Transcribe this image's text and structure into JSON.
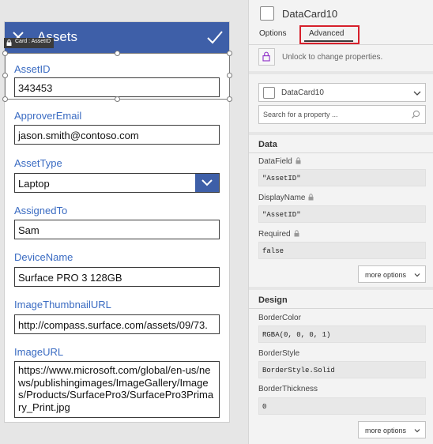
{
  "form": {
    "title": "Assets",
    "card_tag": "Card : AssetID",
    "fields": [
      {
        "label": "AssetID",
        "value": "343453"
      },
      {
        "label": "ApproverEmail",
        "value": "jason.smith@contoso.com"
      },
      {
        "label": "AssetType",
        "value": "Laptop"
      },
      {
        "label": "AssignedTo",
        "value": "Sam"
      },
      {
        "label": "DeviceName",
        "value": "Surface PRO 3 128GB"
      },
      {
        "label": "ImageThumbnailURL",
        "value": "http://compass.surface.com/assets/09/73."
      },
      {
        "label": "ImageURL",
        "value": "https://www.microsoft.com/global/en-us/news/publishingimages/ImageGallery/Images/Products/SurfacePro3/SurfacePro3Primary_Print.jpg"
      }
    ]
  },
  "panel": {
    "title": "DataCard10",
    "tabs": [
      "Options",
      "Advanced"
    ],
    "active_tab": "Advanced",
    "unlock_text": "Unlock to change properties.",
    "card_select_value": "DataCard10",
    "search_placeholder": "Search for a property ...",
    "data_section": {
      "title": "Data",
      "props": [
        {
          "label": "DataField",
          "value": "\"AssetID\""
        },
        {
          "label": "DisplayName",
          "value": "\"AssetID\""
        },
        {
          "label": "Required",
          "value": "false"
        }
      ],
      "more_options": "more options"
    },
    "design_section": {
      "title": "Design",
      "props": [
        {
          "label": "BorderColor",
          "value": "RGBA(0, 0, 0, 1)"
        },
        {
          "label": "BorderStyle",
          "value": "BorderStyle.Solid"
        },
        {
          "label": "BorderThickness",
          "value": "0"
        }
      ],
      "more_options": "more options"
    }
  },
  "colors": {
    "header_blue": "#3e5fa8",
    "label_blue": "#3a6bc2",
    "highlight_red": "#d6202b"
  },
  "icons": [
    "close-icon",
    "check-icon",
    "lock-icon",
    "chevron-down-icon",
    "search-icon"
  ]
}
